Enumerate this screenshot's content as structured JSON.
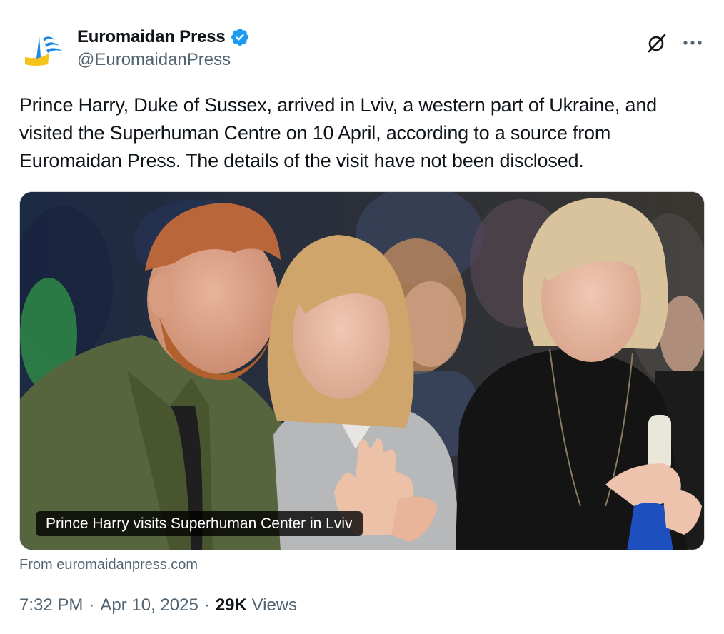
{
  "author": {
    "display_name": "Euromaidan Press",
    "handle": "@EuromaidanPress",
    "avatar_icon": "euromaidan-logo-icon",
    "verified_icon": "verified-badge-icon"
  },
  "header_actions": {
    "grok_icon": "grok-icon",
    "more_icon": "more-dots-icon"
  },
  "tweet": {
    "text": "Prince Harry, Duke of Sussex, arrived in Lviv, a western part of Ukraine, and visited the Superhuman Centre on 10 April, according to a source from Euromaidan Press. The details of the visit have not been disclosed."
  },
  "media": {
    "caption": "Prince Harry visits Superhuman Center in Lviv",
    "source": "From euromaidanpress.com"
  },
  "meta": {
    "time": "7:32 PM",
    "separator": "·",
    "date": "Apr 10, 2025",
    "views_count": "29K",
    "views_label": "Views"
  },
  "colors": {
    "verified_blue": "#1d9bf0",
    "text_primary": "#0f1419",
    "text_secondary": "#536471",
    "logo_yellow": "#f6c21c",
    "logo_blue": "#1e88e5"
  }
}
